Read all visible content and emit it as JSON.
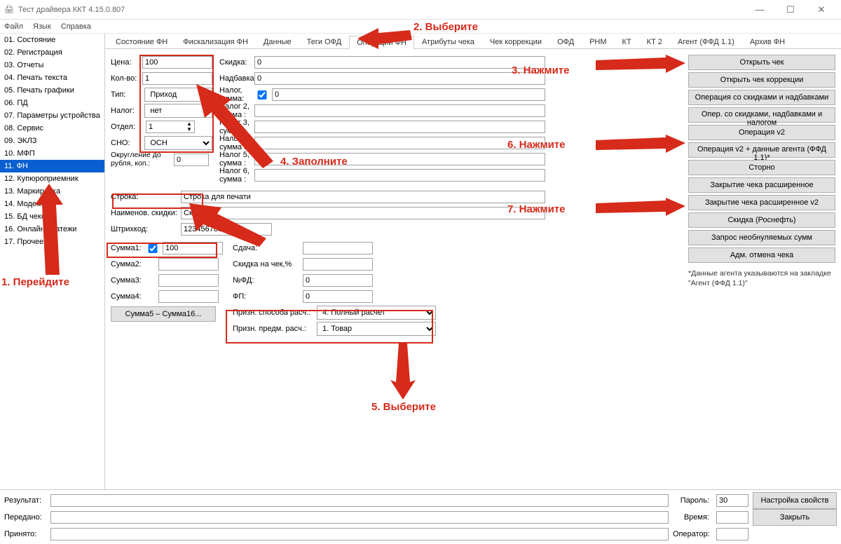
{
  "window": {
    "title": "Тест драйвера ККТ 4.15.0.807"
  },
  "menu": {
    "file": "Файл",
    "lang": "Язык",
    "help": "Справка"
  },
  "sidebar": {
    "items": [
      "01. Состояние",
      "02. Регистрация",
      "03. Отчеты",
      "04. Печать текста",
      "05. Печать графики",
      "06. ПД",
      "07. Параметры устройства",
      "08. Сервис",
      "09. ЭКЛЗ",
      "10. МФП",
      "11. ФН",
      "12. Купюроприемник",
      "13. Маркировка",
      "14. Модем",
      "15. БД чеков",
      "16. Онлайн платежи",
      "17. Прочее"
    ],
    "selected_index": 10
  },
  "tabs": {
    "items": [
      "Состояние ФН",
      "Фискализация ФН",
      "Данные",
      "Теги ОФД",
      "Операции ФН",
      "Атрибуты чека",
      "Чек коррекции",
      "ОФД",
      "РНМ",
      "КТ",
      "КТ 2",
      "Агент (ФФД 1.1)",
      "Архив ФН"
    ],
    "active_index": 4
  },
  "form": {
    "price_lbl": "Цена:",
    "price": "100",
    "qty_lbl": "Кол-во:",
    "qty": "1",
    "type_lbl": "Тип:",
    "type": "Приход",
    "tax_lbl": "Налог:",
    "tax": "нет",
    "dept_lbl": "Отдел:",
    "dept": "1",
    "sno_lbl": "СНО:",
    "sno": "ОСН",
    "round_lbl": "Округление до рубля, коп.:",
    "round": "0",
    "disc_lbl": "Скидка:",
    "disc": "0",
    "surch_lbl": "Надбавка:",
    "surch": "0",
    "tax_sum_lbl": "Налог, сумма:",
    "tax_sum": "0",
    "tax2_lbl": "Налог 2, сумма :",
    "tax2": "",
    "tax3_lbl": "Налог 3, сумма :",
    "tax3": "",
    "tax4_lbl": "Налог 4, сумма :",
    "tax4": "",
    "tax5_lbl": "Налог 5, сумма :",
    "tax5": "",
    "tax6_lbl": "Налог 6, сумма :",
    "tax6": "",
    "stroka_lbl": "Строка:",
    "stroka": "Строка для печати",
    "disc_name_lbl": "Наименов. скидки:",
    "disc_name": "Скидка",
    "barcode_lbl": "Штрихкод:",
    "barcode": "123456789012",
    "sum1_lbl": "Сумма1:",
    "sum1": "100",
    "sum2_lbl": "Сумма2:",
    "sum3_lbl": "Сумма3:",
    "sum4_lbl": "Сумма4:",
    "sum_more": "Сумма5 – Сумма16...",
    "change_lbl": "Сдача:",
    "change": "",
    "disc_chk_lbl": "Скидка на чек,%",
    "disc_chk": "",
    "nfd_lbl": "№ФД:",
    "nfd": "0",
    "fp_lbl": "ФП:",
    "fp": "0",
    "sign_method_lbl": "Призн. способа расч.:",
    "sign_method": "4. Полный расчет",
    "sign_subj_lbl": "Призн. предм. расч.:",
    "sign_subj": "1. Товар"
  },
  "buttons": {
    "open": "Открыть чек",
    "open_corr": "Открыть чек коррекции",
    "op_disc": "Операция со скидками и надбавками",
    "op_disc_tax": "Опер. со скидками, надбавками и налогом",
    "op_v2": "Операция v2",
    "op_v2_agent": "Операция v2 + данные агента (ФФД 1.1)*",
    "storno": "Сторно",
    "close_ext": "Закрытие чека расширенное",
    "close_ext_v2": "Закрытие чека расширенное v2",
    "disc_rn": "Скидка (Роснефть)",
    "req_sum": "Запрос необнуляемых сумм",
    "adm_cancel": "Адм. отмена чека",
    "note": "*Данные агента указываются на закладке \"Агент (ФФД 1.1)\""
  },
  "bottom": {
    "result_lbl": "Результат:",
    "sent_lbl": "Передано:",
    "recv_lbl": "Принято:",
    "pass_lbl": "Пароль:",
    "pass": "30",
    "time_lbl": "Время:",
    "oper_lbl": "Оператор:",
    "settings": "Настройка свойств",
    "close": "Закрыть"
  },
  "annotations": {
    "a1": "1. Перейдите",
    "a2": "2. Выберите",
    "a3": "3. Нажмите",
    "a4": "4. Заполните",
    "a5": "5. Выберите",
    "a6": "6. Нажмите",
    "a7": "7. Нажмите"
  }
}
